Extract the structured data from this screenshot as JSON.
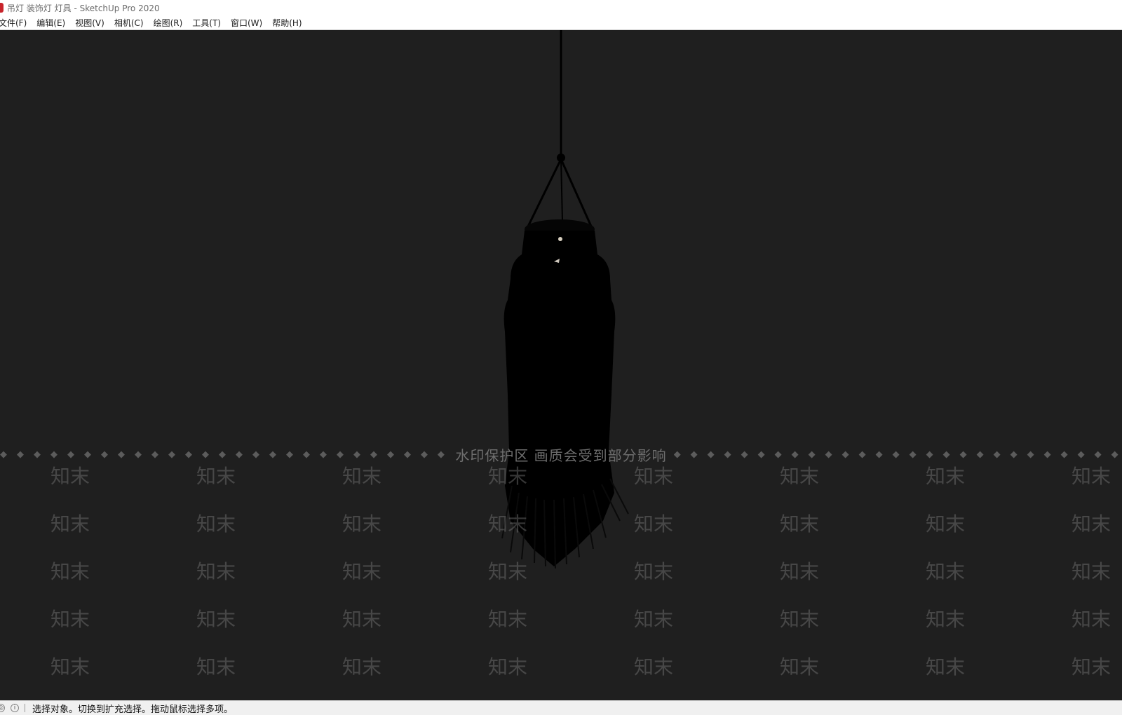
{
  "window": {
    "title": "吊灯 装饰灯 灯具 - SketchUp Pro 2020",
    "app_icon": "sketchup-logo-icon"
  },
  "menu": {
    "items": [
      {
        "label": "文件(F)"
      },
      {
        "label": "编辑(E)"
      },
      {
        "label": "视图(V)"
      },
      {
        "label": "相机(C)"
      },
      {
        "label": "绘图(R)"
      },
      {
        "label": "工具(T)"
      },
      {
        "label": "窗口(W)"
      },
      {
        "label": "帮助(H)"
      }
    ]
  },
  "viewport": {
    "background": "#1f1f1f",
    "model_color": "#000000",
    "watermark": {
      "notice": "水印保护区  画质会受到部分影响",
      "dots": "◆◆◆◆◆◆◆◆◆◆◆◆◆◆◆◆◆◆◆◆◆◆◆◆◆◆◆◆◆◆",
      "brand": "知末"
    }
  },
  "statusbar": {
    "icons": [
      "geo-location-icon",
      "info-icon"
    ],
    "hint": "选择对象。切换到扩充选择。拖动鼠标选择多项。"
  }
}
